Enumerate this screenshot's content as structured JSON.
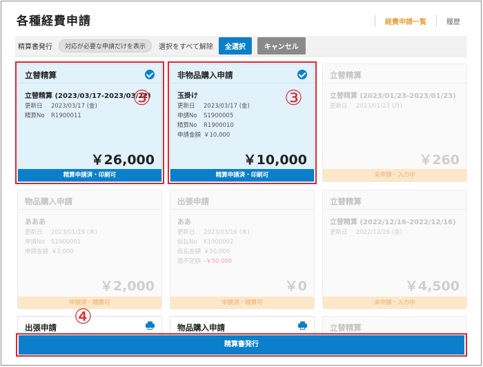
{
  "header": {
    "title": "各種経費申請",
    "nav": [
      {
        "label": "経費申請一覧",
        "active": true
      },
      {
        "label": "履歴",
        "active": false
      }
    ]
  },
  "toolbar": {
    "issue_label": "精算書発行",
    "filter_pill": "対応が必要な申請だけを表示",
    "clear_all": "選択をすべて解除",
    "select_all": "全選択",
    "cancel": "キャンセル"
  },
  "cards": [
    {
      "title": "立替精算",
      "selected": true,
      "subtitle": "立替精算 (2023/03/17-2023/03/22)",
      "rows": [
        {
          "k": "更新日",
          "v": "2023/03/17 (金)"
        },
        {
          "k": "精算No",
          "v": "R1900011"
        }
      ],
      "amount": "￥26,000",
      "status": "精算申請済・印刷可"
    },
    {
      "title": "非物品購入申請",
      "selected": true,
      "subtitle": "玉掛け",
      "rows": [
        {
          "k": "更新日",
          "v": "2023/03/17 (金)"
        },
        {
          "k": "申請No",
          "v": "S1900005"
        },
        {
          "k": "精算No",
          "v": "R1900010"
        },
        {
          "k": "申請金額",
          "v": "￥10,000"
        }
      ],
      "amount": "￥10,000",
      "status": "精算申請済・印刷可"
    },
    {
      "title": "立替精算",
      "selected": false,
      "subtitle": "立替精算 (2023/01/23-2023/01/23)",
      "rows": [
        {
          "k": "更新日",
          "v": "2023/01/23 (月)"
        }
      ],
      "amount": "￥260",
      "status": "未申請・入力中"
    },
    {
      "title": "物品購入申請",
      "selected": false,
      "subtitle": "あああ",
      "rows": [
        {
          "k": "更新日",
          "v": "2023/01/19 (木)"
        },
        {
          "k": "申請No",
          "v": "S1900001"
        },
        {
          "k": "申請金額",
          "v": "￥2,000"
        }
      ],
      "amount": "￥2,000",
      "status": "申請済・精算可"
    },
    {
      "title": "出張申請",
      "selected": false,
      "subtitle": "ああ",
      "rows": [
        {
          "k": "更新日",
          "v": "2023/03/16 (木)"
        },
        {
          "k": "仮払No",
          "v": "K1900002"
        },
        {
          "k": "仮払金額",
          "v": "￥50,000"
        },
        {
          "k": "過不足額",
          "v": "-￥50,000"
        }
      ],
      "amount": "￥0",
      "status": "申請済・精算可"
    },
    {
      "title": "立替精算",
      "selected": false,
      "subtitle": "立替精算 (2022/12/16-2022/12/16)",
      "rows": [
        {
          "k": "更新日",
          "v": "2022/12/16 (金)"
        }
      ],
      "amount": "￥4,500",
      "status": "未申請・入力中"
    },
    {
      "title": "出張申請",
      "selected": false
    },
    {
      "title": "物品購入申請",
      "selected": false
    },
    {
      "title": "立替精算",
      "selected": false
    }
  ],
  "callouts": [
    "③",
    "③",
    "④"
  ],
  "issue_button": "精算書発行",
  "colors": {
    "primary": "#0b7fcb",
    "accent": "#e8a23a",
    "highlight": "#d9262e"
  }
}
